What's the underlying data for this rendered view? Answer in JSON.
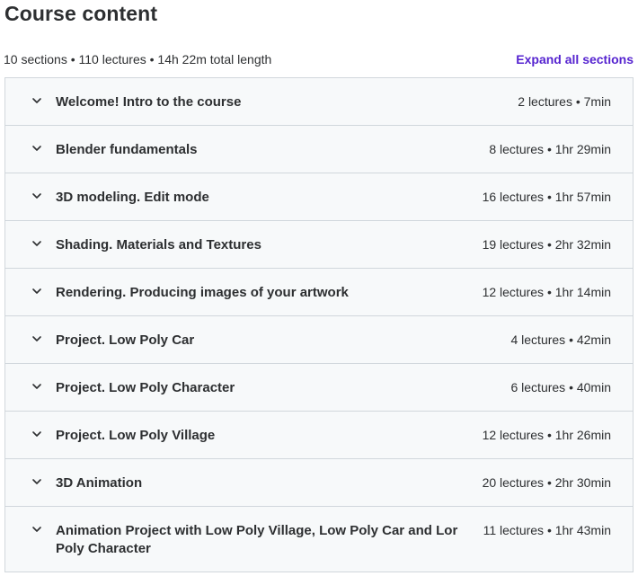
{
  "header": {
    "title": "Course content",
    "summary": "10 sections • 110 lectures • 14h 22m total length",
    "expand_label": "Expand all sections"
  },
  "colors": {
    "accent": "#5624d0",
    "text": "#2d2f31",
    "section_bg": "#f7f9fa",
    "border": "#d1d7dc"
  },
  "sections": [
    {
      "title": "Welcome! Intro to the course",
      "meta": "2 lectures • 7min",
      "icon": "chevron-down-icon"
    },
    {
      "title": "Blender fundamentals",
      "meta": "8 lectures • 1hr 29min",
      "icon": "chevron-down-icon"
    },
    {
      "title": "3D modeling. Edit mode",
      "meta": "16 lectures • 1hr 57min",
      "icon": "chevron-down-icon"
    },
    {
      "title": "Shading. Materials and Textures",
      "meta": "19 lectures • 2hr 32min",
      "icon": "chevron-down-icon"
    },
    {
      "title": "Rendering. Producing images of your artwork",
      "meta": "12 lectures • 1hr 14min",
      "icon": "chevron-down-icon"
    },
    {
      "title": "Project. Low Poly Car",
      "meta": "4 lectures • 42min",
      "icon": "chevron-down-icon"
    },
    {
      "title": "Project. Low Poly Character",
      "meta": "6 lectures • 40min",
      "icon": "chevron-down-icon"
    },
    {
      "title": "Project. Low Poly Village",
      "meta": "12 lectures • 1hr 26min",
      "icon": "chevron-down-icon"
    },
    {
      "title": "3D Animation",
      "meta": "20 lectures • 2hr 30min",
      "icon": "chevron-down-icon"
    },
    {
      "title": "Animation Project with Low Poly Village, Low Poly Car and Lor Poly Character",
      "meta": "11 lectures • 1hr 43min",
      "icon": "chevron-down-icon"
    }
  ]
}
